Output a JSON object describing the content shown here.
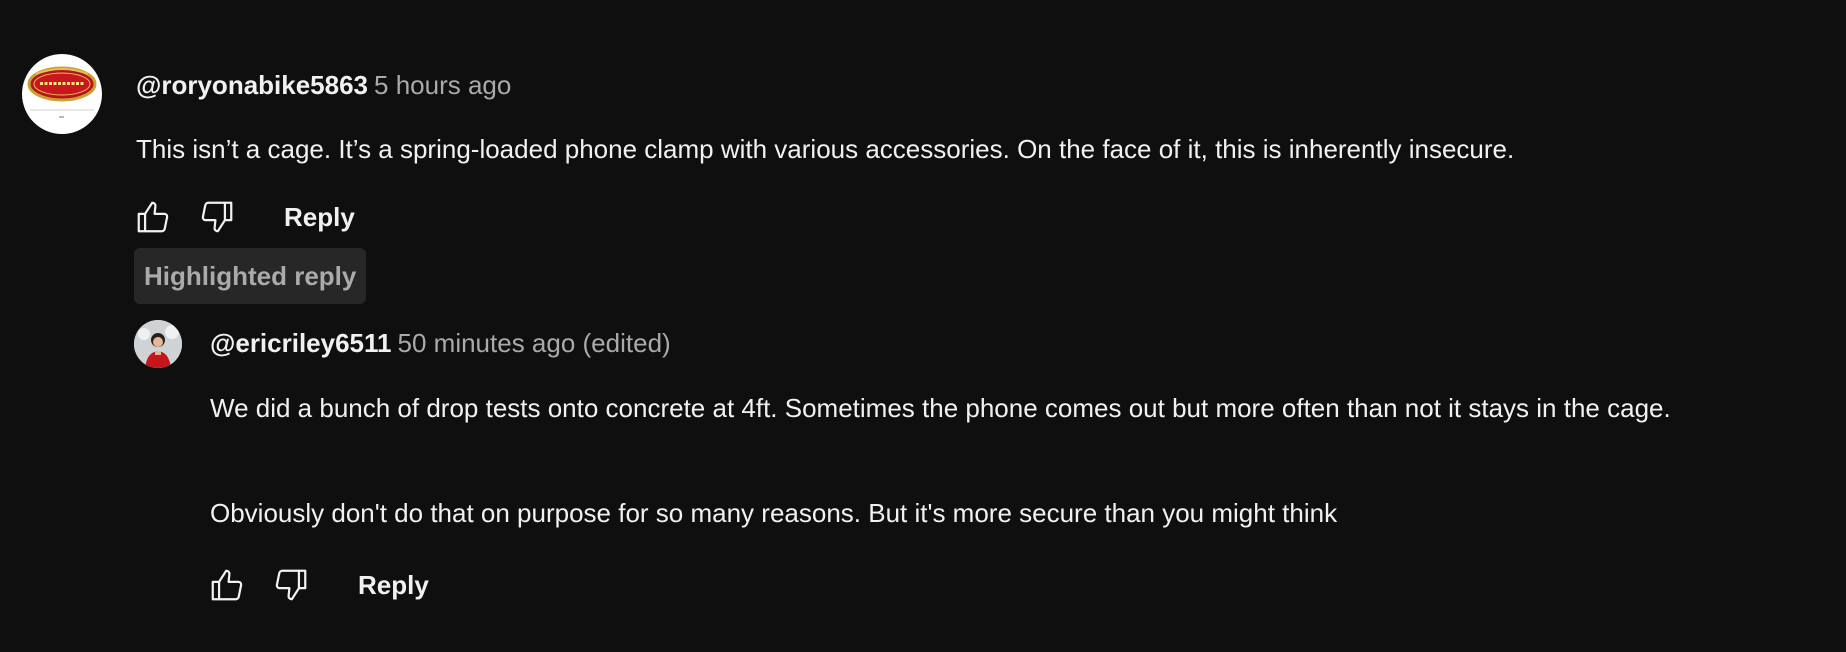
{
  "comment": {
    "handle": "@roryonabike5863",
    "timestamp": "5 hours ago",
    "text": "This isn’t a cage. It’s a spring-loaded phone clamp with various accessories. On the face of it, this is inherently insecure.",
    "avatar_icon": "moto-guzzi-logo-icon",
    "reply_label": "Reply",
    "highlighted_label": "Highlighted reply"
  },
  "reply": {
    "handle": "@ericriley6511",
    "timestamp": "50 minutes ago (edited)",
    "text_line1": "We did a bunch of drop tests onto concrete at 4ft. Sometimes the phone comes out but more often than not it stays in the cage.",
    "text_line2": "Obviously don't do that on purpose for so many reasons. But it's more secure than you might think",
    "avatar_icon": "person-avatar-icon",
    "reply_label": "Reply"
  },
  "colors": {
    "background": "#0f0f0f",
    "text_primary": "#f1f1f1",
    "text_secondary": "#aaaaaa",
    "badge_bg": "#272727"
  }
}
